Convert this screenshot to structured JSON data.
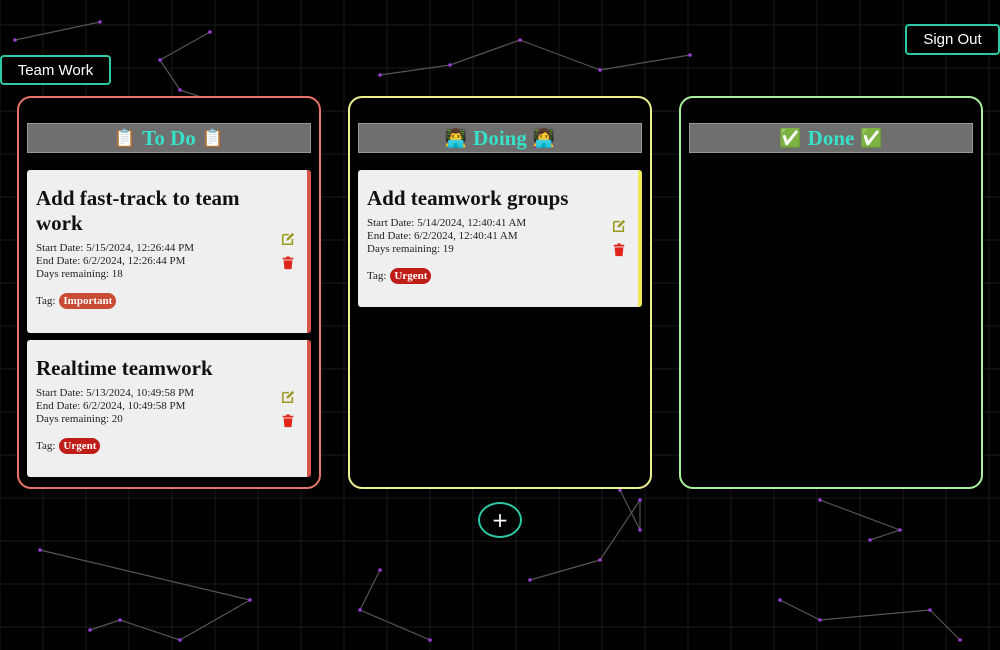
{
  "header": {
    "team_label": "Team Work",
    "sign_out_label": "Sign Out"
  },
  "columns": [
    {
      "title": "To Do",
      "emoji": "📋",
      "border_color": "#e8736b",
      "cards": [
        {
          "title": "Add fast-track to team work",
          "start": "Start Date: 5/15/2024, 12:26:44 PM",
          "end": "End Date: 6/2/2024, 12:26:44 PM",
          "days": "Days remaining:  18",
          "tag_label": "Tag:",
          "tag": "Important"
        },
        {
          "title": "Realtime teamwork",
          "start": "Start Date: 5/13/2024, 10:49:58 PM",
          "end": "End Date: 6/2/2024, 10:49:58 PM",
          "days": "Days remaining:  20",
          "tag_label": "Tag:",
          "tag": "Urgent"
        }
      ]
    },
    {
      "title": "Doing",
      "emoji": "👨‍💻",
      "emoji_right": "👩‍💻",
      "border_color": "#eef08f",
      "cards": [
        {
          "title": "Add teamwork groups",
          "start": "Start Date: 5/14/2024, 12:40:41 AM",
          "end": "End Date: 6/2/2024, 12:40:41 AM",
          "days": "Days remaining:  19",
          "tag_label": "Tag:",
          "tag": "Urgent"
        }
      ]
    },
    {
      "title": "Done",
      "emoji": "✅",
      "border_color": "#a9ef9e",
      "cards": []
    }
  ],
  "add_button_label": "+",
  "colors": {
    "accent": "#2ec8a6",
    "header_text": "#37e0c8",
    "important": "#c94a35",
    "urgent": "#c01d18",
    "edit_icon": "#9a9a1e",
    "delete_icon": "#e0241b"
  },
  "icons": [
    "edit-icon",
    "trash-icon",
    "plus-icon"
  ]
}
